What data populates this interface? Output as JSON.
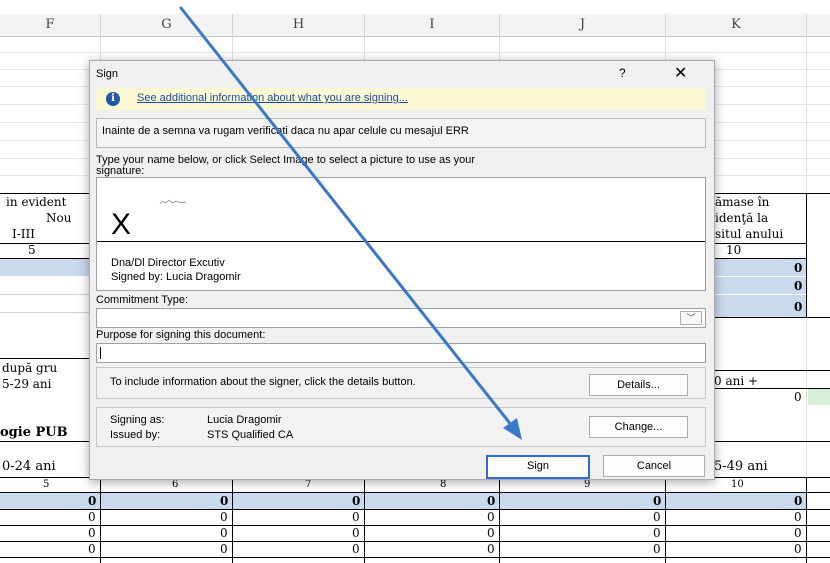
{
  "spreadsheet": {
    "columns": [
      "F",
      "G",
      "H",
      "I",
      "J",
      "K"
    ],
    "left_header": {
      "line1": "in evident",
      "line2": "Nou",
      "line3": "I-III",
      "line4": "5"
    },
    "right_header": {
      "line1": "ămase în",
      "line2": "idenţă la",
      "line3": "situl anului",
      "line4": "10"
    },
    "right_values": [
      "0",
      "0",
      "0"
    ],
    "mid_left": {
      "row1": "după gru",
      "row2": "5-29 ani"
    },
    "mid_right": {
      "row1": "0 ani +",
      "row2": "0"
    },
    "ogie": "ogie PUB",
    "bottom_left": "0-24 ani",
    "bottom_right": "5-49 ani",
    "bottom_index": [
      "5",
      "6",
      "7",
      "8",
      "9",
      "10"
    ],
    "bottom_rows": [
      [
        "0",
        "0",
        "0",
        "0",
        "0",
        "0"
      ],
      [
        "0",
        "0",
        "0",
        "0",
        "0",
        "0"
      ],
      [
        "0",
        "0",
        "0",
        "0",
        "0",
        "0"
      ],
      [
        "0",
        "0",
        "0",
        "0",
        "0",
        "0"
      ]
    ]
  },
  "dialog": {
    "title": "Sign",
    "help": "?",
    "close": "✕",
    "info_link": "See additional information about what you are signing...",
    "message": "Inainte de a semna va rugam verificati daca nu apar celule cu mesajul ERR",
    "instruction_line1": "Type your name below, or click Select Image to select a picture to use as your",
    "instruction_line2": "signature:",
    "signature_x": "X",
    "signer_title": "Dna/Dl Director Excutiv",
    "signed_by": "Signed by: Lucia Dragomir",
    "commitment_label": "Commitment Type:",
    "commitment_value": "",
    "purpose_label": "Purpose for signing this document:",
    "purpose_value": "",
    "details_text": "To include information about the signer, click the details button.",
    "details_button": "Details...",
    "signing_as_label": "Signing as:",
    "signing_as_value": "Lucia Dragomir",
    "issued_by_label": "Issued by:",
    "issued_by_value": "STS Qualified CA",
    "change_button": "Change...",
    "sign_button": "Sign",
    "cancel_button": "Cancel"
  },
  "colors": {
    "accent": "#2f6bd8",
    "info_bg": "#fcf8d4",
    "arrow": "#3a78c8",
    "row_blue": "#c9d9ee"
  }
}
